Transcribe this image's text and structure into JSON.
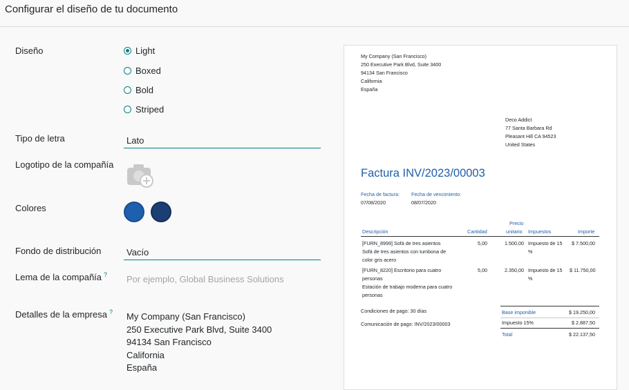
{
  "header": {
    "title": "Configurar el diseño de tu documento"
  },
  "form": {
    "layout_label": "Diseño",
    "layout_options": [
      {
        "label": "Light",
        "checked": true
      },
      {
        "label": "Boxed",
        "checked": false
      },
      {
        "label": "Bold",
        "checked": false
      },
      {
        "label": "Striped",
        "checked": false
      }
    ],
    "font_label": "Tipo de letra",
    "font_value": "Lato",
    "logo_label": "Logotipo de la compañía",
    "colors_label": "Colores",
    "colors": [
      "#1e5fae",
      "#1b3f74"
    ],
    "background_label": "Fondo de distribución",
    "background_value": "Vacío",
    "tagline_label": "Lema de la compañía",
    "tagline_help": "?",
    "tagline_placeholder": "Por ejemplo, Global Business Solutions",
    "details_label": "Detalles de la empresa",
    "details_help": "?",
    "details_lines": [
      "My Company (San Francisco)",
      "250 Executive Park Blvd, Suite 3400",
      "94134 San Francisco",
      "California",
      "España"
    ]
  },
  "preview": {
    "company_lines": [
      "My Company (San Francisco)",
      "250 Executive Park Blvd, Suite 3400",
      "94134 San Francisco",
      "California",
      "España"
    ],
    "customer_lines": [
      "Deco Addict",
      "77 Santa Barbara Rd",
      "Pleasant Hill CA 94523",
      "United States"
    ],
    "invoice_title": "Factura INV/2023/00003",
    "invoice_date_label": "Fecha de factura:",
    "invoice_date": "07/08/2020",
    "due_date_label": "Fecha de vencimiento:",
    "due_date": "08/07/2020",
    "columns": {
      "description": "Descripción",
      "quantity": "Cantidad",
      "price_1": "Precio",
      "price_2": "unitario",
      "taxes": "Impuestos",
      "amount": "Importe"
    },
    "lines": [
      {
        "desc": [
          "[FURN_8999] Sofá de tres asientos",
          "Sofá de tres asientos con tumbona de",
          "color gris acero"
        ],
        "qty": "5,00",
        "price": "1.500,00",
        "tax": [
          "Impuesto de 15",
          "%"
        ],
        "amount": "$ 7.500,00"
      },
      {
        "desc": [
          "[FURN_8220] Escritorio para cuatro",
          "personas",
          "Estación de trabajo moderna para cuatro",
          "personas"
        ],
        "qty": "5,00",
        "price": "2.350,00",
        "tax": [
          "Impuesto de 15",
          "%"
        ],
        "amount": "$ 11.750,00"
      }
    ],
    "payment_terms": "Condiciones de pago: 30 días",
    "communication_label": "Comunicación de pago: ",
    "communication_value": "INV/2023/00003",
    "totals": {
      "base_label": "Base imponible",
      "base_value": "$ 19.250,00",
      "tax_label": "Impuesto 15%",
      "tax_value": "$ 2.887,50",
      "total_label": "Total",
      "total_value": "$ 22.137,50"
    }
  }
}
